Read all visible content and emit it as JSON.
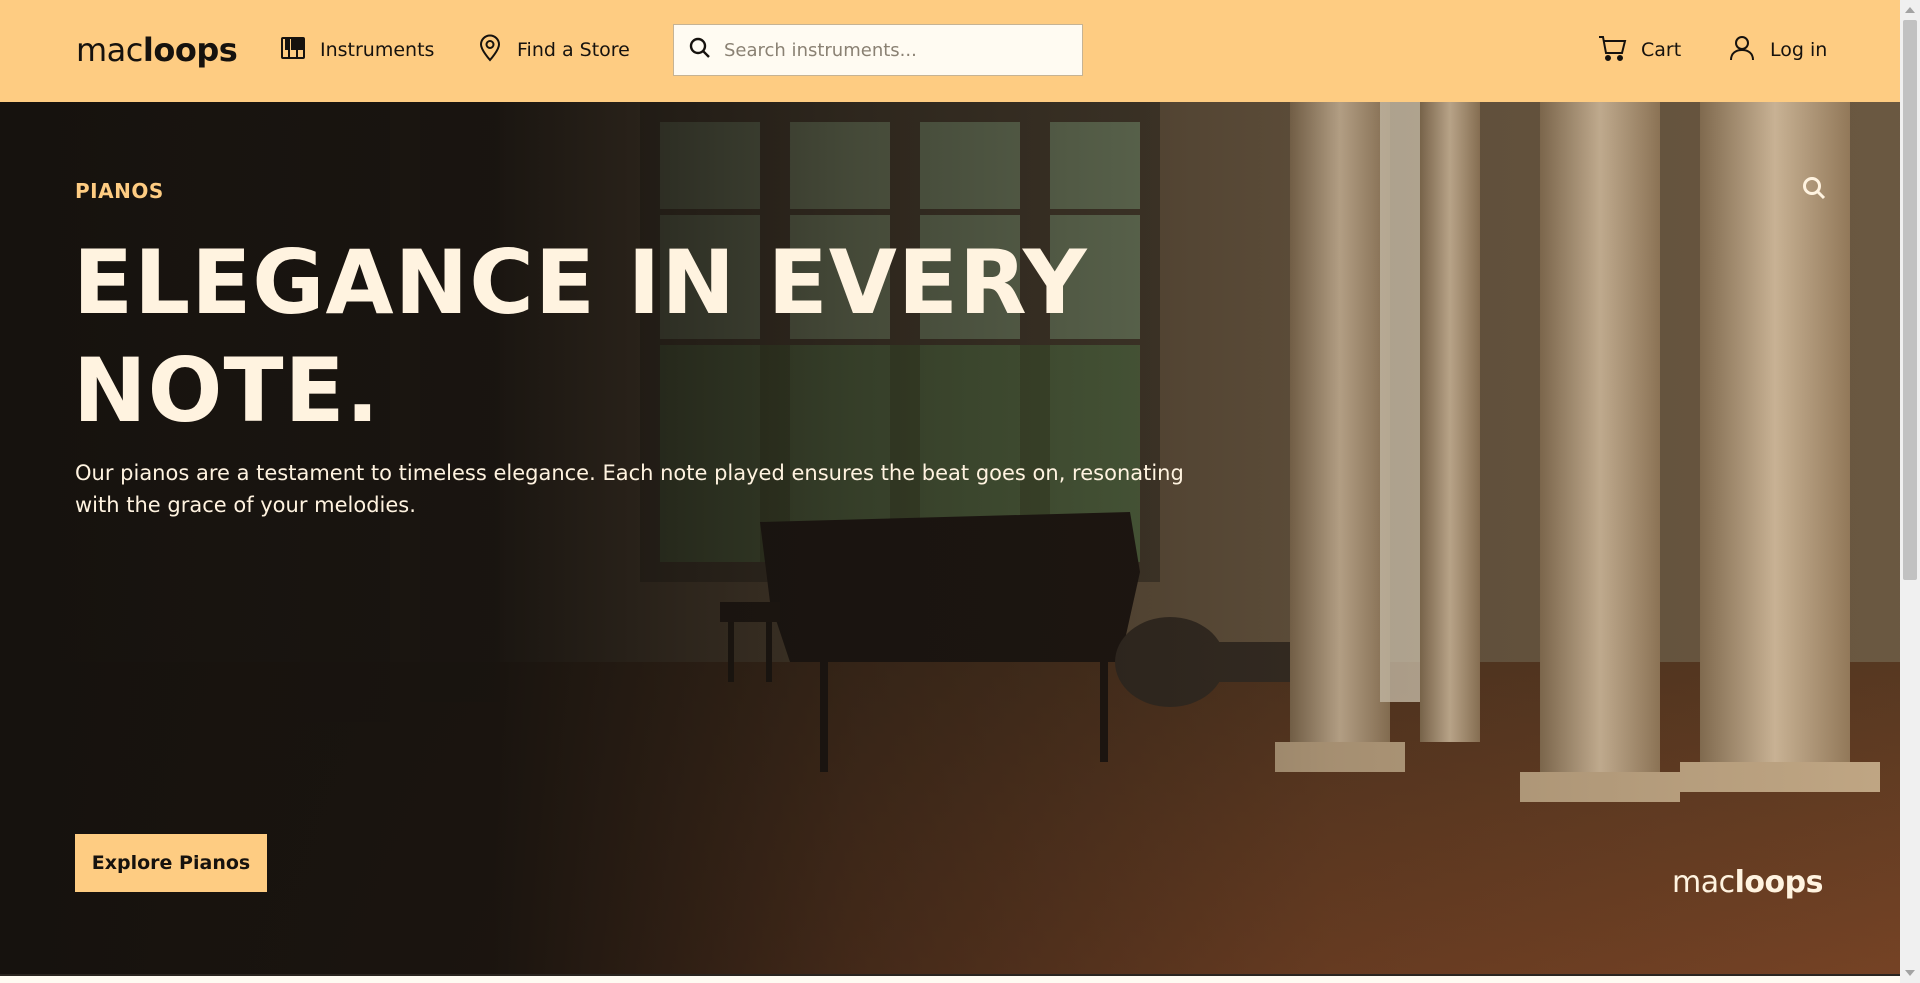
{
  "header": {
    "logo": {
      "light": "mac",
      "loop": "loo",
      "bold": "ps"
    },
    "nav": {
      "instruments_label": "Instruments",
      "store_label": "Find a Store",
      "cart_label": "Cart",
      "login_label": "Log in"
    },
    "search": {
      "placeholder": "Search instruments...",
      "value": ""
    },
    "icons": [
      "piano-icon",
      "location-pin-icon",
      "search-icon",
      "cart-icon",
      "user-icon"
    ]
  },
  "hero": {
    "eyebrow": "PIANOS",
    "title": "ELEGANCE IN EVERY NOTE.",
    "description": "Our pianos are a testament to timeless elegance. Each note played ensures the beat goes on, resonating with the grace of your melodies.",
    "cta_label": "Explore Pianos",
    "logo": {
      "light": "mac",
      "loop": "loo",
      "bold": "ps"
    },
    "icons": [
      "search-icon"
    ]
  },
  "colors": {
    "accent": "#fecc82",
    "dark": "#16120e",
    "light_text": "#fff3e0"
  }
}
